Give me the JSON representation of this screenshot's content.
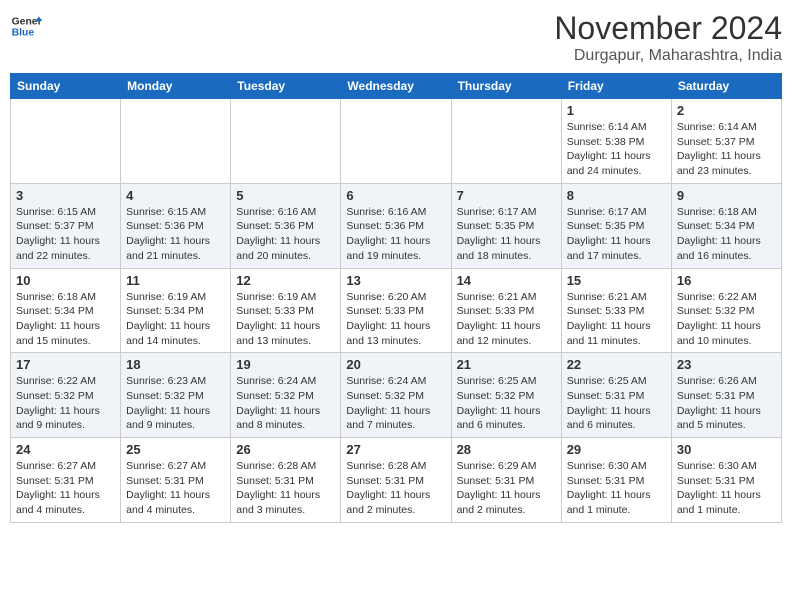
{
  "header": {
    "logo_line1": "General",
    "logo_line2": "Blue",
    "month_title": "November 2024",
    "location": "Durgapur, Maharashtra, India"
  },
  "weekdays": [
    "Sunday",
    "Monday",
    "Tuesday",
    "Wednesday",
    "Thursday",
    "Friday",
    "Saturday"
  ],
  "weeks": [
    [
      {
        "day": "",
        "info": ""
      },
      {
        "day": "",
        "info": ""
      },
      {
        "day": "",
        "info": ""
      },
      {
        "day": "",
        "info": ""
      },
      {
        "day": "",
        "info": ""
      },
      {
        "day": "1",
        "info": "Sunrise: 6:14 AM\nSunset: 5:38 PM\nDaylight: 11 hours and 24 minutes."
      },
      {
        "day": "2",
        "info": "Sunrise: 6:14 AM\nSunset: 5:37 PM\nDaylight: 11 hours and 23 minutes."
      }
    ],
    [
      {
        "day": "3",
        "info": "Sunrise: 6:15 AM\nSunset: 5:37 PM\nDaylight: 11 hours and 22 minutes."
      },
      {
        "day": "4",
        "info": "Sunrise: 6:15 AM\nSunset: 5:36 PM\nDaylight: 11 hours and 21 minutes."
      },
      {
        "day": "5",
        "info": "Sunrise: 6:16 AM\nSunset: 5:36 PM\nDaylight: 11 hours and 20 minutes."
      },
      {
        "day": "6",
        "info": "Sunrise: 6:16 AM\nSunset: 5:36 PM\nDaylight: 11 hours and 19 minutes."
      },
      {
        "day": "7",
        "info": "Sunrise: 6:17 AM\nSunset: 5:35 PM\nDaylight: 11 hours and 18 minutes."
      },
      {
        "day": "8",
        "info": "Sunrise: 6:17 AM\nSunset: 5:35 PM\nDaylight: 11 hours and 17 minutes."
      },
      {
        "day": "9",
        "info": "Sunrise: 6:18 AM\nSunset: 5:34 PM\nDaylight: 11 hours and 16 minutes."
      }
    ],
    [
      {
        "day": "10",
        "info": "Sunrise: 6:18 AM\nSunset: 5:34 PM\nDaylight: 11 hours and 15 minutes."
      },
      {
        "day": "11",
        "info": "Sunrise: 6:19 AM\nSunset: 5:34 PM\nDaylight: 11 hours and 14 minutes."
      },
      {
        "day": "12",
        "info": "Sunrise: 6:19 AM\nSunset: 5:33 PM\nDaylight: 11 hours and 13 minutes."
      },
      {
        "day": "13",
        "info": "Sunrise: 6:20 AM\nSunset: 5:33 PM\nDaylight: 11 hours and 13 minutes."
      },
      {
        "day": "14",
        "info": "Sunrise: 6:21 AM\nSunset: 5:33 PM\nDaylight: 11 hours and 12 minutes."
      },
      {
        "day": "15",
        "info": "Sunrise: 6:21 AM\nSunset: 5:33 PM\nDaylight: 11 hours and 11 minutes."
      },
      {
        "day": "16",
        "info": "Sunrise: 6:22 AM\nSunset: 5:32 PM\nDaylight: 11 hours and 10 minutes."
      }
    ],
    [
      {
        "day": "17",
        "info": "Sunrise: 6:22 AM\nSunset: 5:32 PM\nDaylight: 11 hours and 9 minutes."
      },
      {
        "day": "18",
        "info": "Sunrise: 6:23 AM\nSunset: 5:32 PM\nDaylight: 11 hours and 9 minutes."
      },
      {
        "day": "19",
        "info": "Sunrise: 6:24 AM\nSunset: 5:32 PM\nDaylight: 11 hours and 8 minutes."
      },
      {
        "day": "20",
        "info": "Sunrise: 6:24 AM\nSunset: 5:32 PM\nDaylight: 11 hours and 7 minutes."
      },
      {
        "day": "21",
        "info": "Sunrise: 6:25 AM\nSunset: 5:32 PM\nDaylight: 11 hours and 6 minutes."
      },
      {
        "day": "22",
        "info": "Sunrise: 6:25 AM\nSunset: 5:31 PM\nDaylight: 11 hours and 6 minutes."
      },
      {
        "day": "23",
        "info": "Sunrise: 6:26 AM\nSunset: 5:31 PM\nDaylight: 11 hours and 5 minutes."
      }
    ],
    [
      {
        "day": "24",
        "info": "Sunrise: 6:27 AM\nSunset: 5:31 PM\nDaylight: 11 hours and 4 minutes."
      },
      {
        "day": "25",
        "info": "Sunrise: 6:27 AM\nSunset: 5:31 PM\nDaylight: 11 hours and 4 minutes."
      },
      {
        "day": "26",
        "info": "Sunrise: 6:28 AM\nSunset: 5:31 PM\nDaylight: 11 hours and 3 minutes."
      },
      {
        "day": "27",
        "info": "Sunrise: 6:28 AM\nSunset: 5:31 PM\nDaylight: 11 hours and 2 minutes."
      },
      {
        "day": "28",
        "info": "Sunrise: 6:29 AM\nSunset: 5:31 PM\nDaylight: 11 hours and 2 minutes."
      },
      {
        "day": "29",
        "info": "Sunrise: 6:30 AM\nSunset: 5:31 PM\nDaylight: 11 hours and 1 minute."
      },
      {
        "day": "30",
        "info": "Sunrise: 6:30 AM\nSunset: 5:31 PM\nDaylight: 11 hours and 1 minute."
      }
    ]
  ]
}
